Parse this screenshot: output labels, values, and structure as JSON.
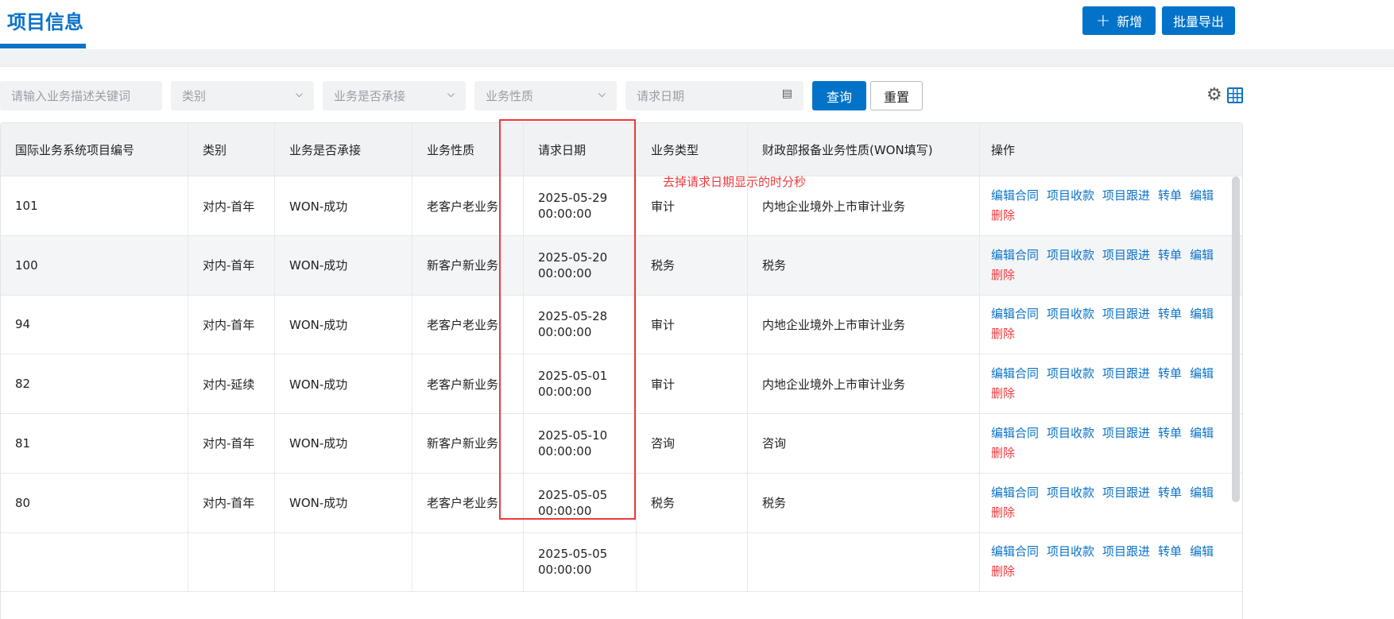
{
  "header": {
    "title": "项目信息",
    "add_label": "新增",
    "add_icon": "plus-icon",
    "export_label": "批量导出"
  },
  "filters": {
    "keyword_placeholder": "请输入业务描述关键词",
    "category": "类别",
    "undertaken": "业务是否承接",
    "nature": "业务性质",
    "date": "请求日期",
    "query": "查询",
    "reset": "重置"
  },
  "columns": [
    "国际业务系统项目编号",
    "类别",
    "业务是否承接",
    "业务性质",
    "请求日期",
    "业务类型",
    "财政部报备业务性质(WON填写)",
    "操作"
  ],
  "actions": {
    "edit_contract": "编辑合同",
    "collection": "项目收款",
    "follow": "项目跟进",
    "transfer": "转单",
    "edit": "编辑",
    "delete": "删除"
  },
  "rows": [
    {
      "id": "101",
      "category": "对内-首年",
      "undertaken": "WON-成功",
      "nature": "老客户老业务",
      "date": "2025-05-29 00:00:00",
      "type": "审计",
      "won": "内地企业境外上市审计业务"
    },
    {
      "id": "100",
      "category": "对内-首年",
      "undertaken": "WON-成功",
      "nature": "新客户新业务",
      "date": "2025-05-20 00:00:00",
      "type": "税务",
      "won": "税务"
    },
    {
      "id": "94",
      "category": "对内-首年",
      "undertaken": "WON-成功",
      "nature": "老客户老业务",
      "date": "2025-05-28 00:00:00",
      "type": "审计",
      "won": "内地企业境外上市审计业务"
    },
    {
      "id": "82",
      "category": "对内-延续",
      "undertaken": "WON-成功",
      "nature": "老客户新业务",
      "date": "2025-05-01 00:00:00",
      "type": "审计",
      "won": "内地企业境外上市审计业务"
    },
    {
      "id": "81",
      "category": "对内-首年",
      "undertaken": "WON-成功",
      "nature": "新客户新业务",
      "date": "2025-05-10 00:00:00",
      "type": "咨询",
      "won": "咨询"
    },
    {
      "id": "80",
      "category": "对内-首年",
      "undertaken": "WON-成功",
      "nature": "老客户老业务",
      "date": "2025-05-05 00:00:00",
      "type": "税务",
      "won": "税务"
    },
    {
      "id": "",
      "category": "",
      "undertaken": "",
      "nature": "",
      "date": "2025-05-05 00:00:00",
      "type": "",
      "won": ""
    }
  ],
  "annotation": {
    "text": "去掉请求日期显示的时分秒",
    "color": "#f0383b"
  }
}
